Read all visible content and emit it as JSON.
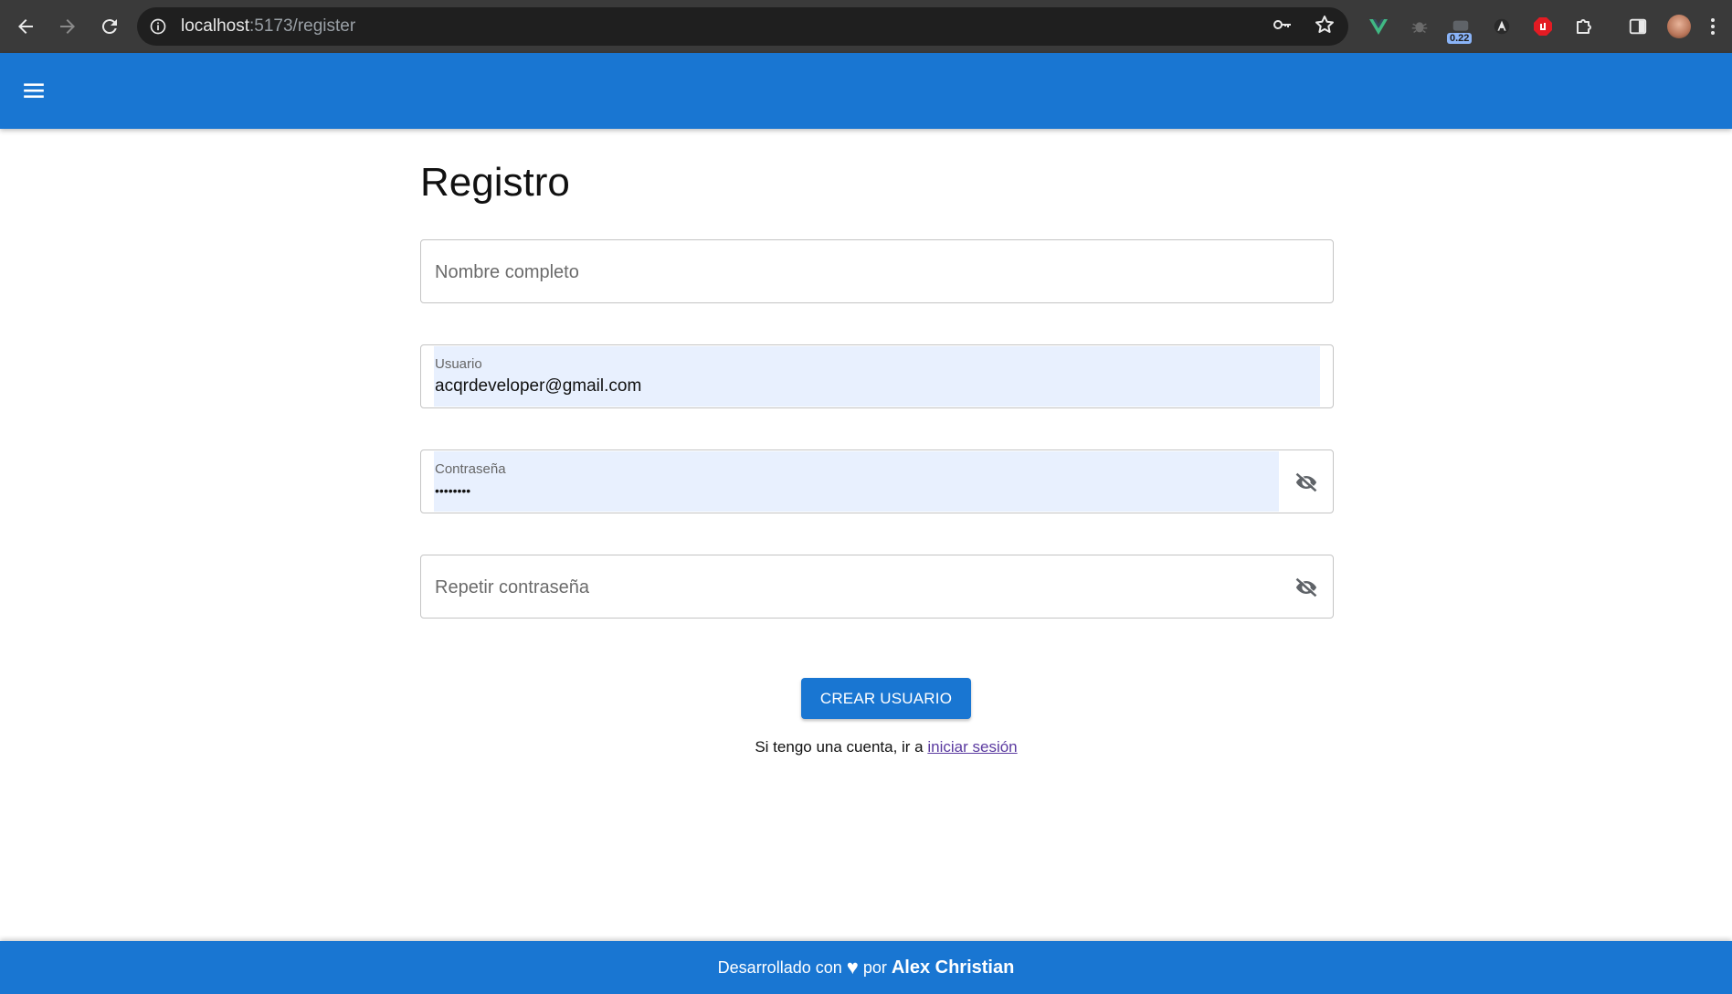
{
  "browser": {
    "url_host": "localhost",
    "url_rest": ":5173/register",
    "extension_badge": "0.22"
  },
  "page": {
    "title": "Registro",
    "fields": {
      "fullname": {
        "placeholder": "Nombre completo",
        "value": ""
      },
      "username": {
        "label": "Usuario",
        "value": "acqrdeveloper@gmail.com"
      },
      "password": {
        "label": "Contraseña",
        "value": "••••••••"
      },
      "repeat_password": {
        "placeholder": "Repetir contraseña",
        "value": ""
      }
    },
    "submit_label": "CREAR USUARIO",
    "login_prompt": "Si tengo una cuenta, ir a",
    "login_link": "iniciar sesión"
  },
  "footer": {
    "prefix": "Desarrollado con",
    "heart": "♥",
    "by": "por",
    "author": "Alex Christian"
  },
  "colors": {
    "primary": "#1976d2",
    "autofill": "#e8f0fe",
    "link": "#5b3aa0"
  },
  "icons": [
    "back-arrow-icon",
    "forward-arrow-icon",
    "reload-icon",
    "info-icon",
    "key-icon",
    "star-icon",
    "vue-devtools-icon",
    "extension-icon",
    "puzzle-icon",
    "sidepanel-icon",
    "menu-icon",
    "eye-off-icon"
  ]
}
